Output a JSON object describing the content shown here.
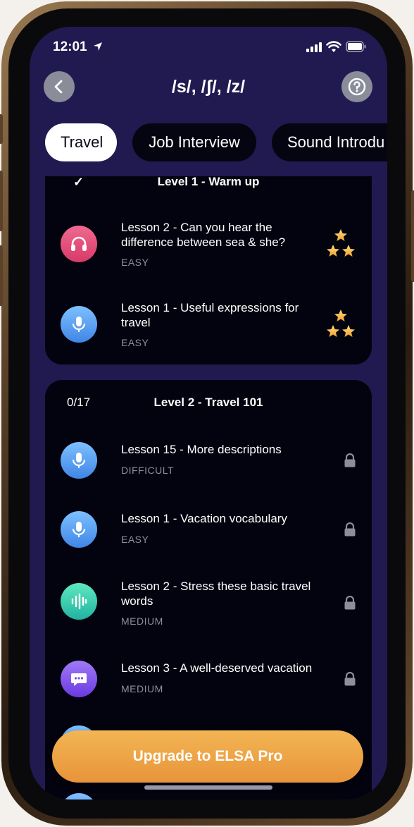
{
  "status": {
    "time": "12:01"
  },
  "header": {
    "title": "/s/, /ʃ/, /z/"
  },
  "tabs": [
    {
      "label": "Travel",
      "active": true
    },
    {
      "label": "Job Interview",
      "active": false
    },
    {
      "label": "Sound Introdu",
      "active": false
    }
  ],
  "level1": {
    "title": "Level 1 - Warm up",
    "check": "✓",
    "lessons": [
      {
        "title": "Lesson 2 - Can you hear the difference between sea & she?",
        "difficulty": "EASY",
        "icon": "headphones-icon",
        "color": "#e8507a",
        "stars": 3
      },
      {
        "title": "Lesson 1 - Useful expressions for travel",
        "difficulty": "EASY",
        "icon": "microphone-icon",
        "color": "#5aa0f0",
        "stars": 3
      }
    ]
  },
  "level2": {
    "title": "Level 2 - Travel 101",
    "count": "0/17",
    "lessons": [
      {
        "title": "Lesson 15 - More descriptions",
        "difficulty": "DIFFICULT",
        "icon": "microphone-icon",
        "color": "#5aa0f0",
        "locked": true
      },
      {
        "title": "Lesson 1 - Vacation vocabulary",
        "difficulty": "EASY",
        "icon": "microphone-icon",
        "color": "#5aa0f0",
        "locked": true
      },
      {
        "title": "Lesson 2 - Stress these basic travel words",
        "difficulty": "MEDIUM",
        "icon": "sound-wave-icon",
        "color": "#3ad0b0",
        "locked": true
      },
      {
        "title": "Lesson 3 - A well-deserved vacation",
        "difficulty": "MEDIUM",
        "icon": "chat-bubble-icon",
        "color": "#8a5af0",
        "locked": true
      }
    ]
  },
  "upgrade": {
    "label": "Upgrade to ELSA Pro"
  },
  "colors": {
    "background": "#201a50",
    "card": "#03030f",
    "upgrade": "#f0a548",
    "star": "#f5b93a"
  }
}
